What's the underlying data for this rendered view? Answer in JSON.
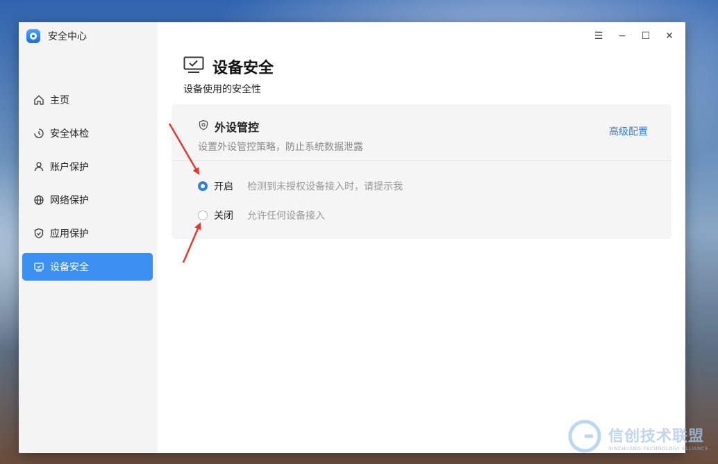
{
  "app": {
    "title": "安全中心"
  },
  "sidebar": {
    "items": [
      {
        "label": "主页",
        "icon": "home-icon"
      },
      {
        "label": "安全体检",
        "icon": "scan-icon"
      },
      {
        "label": "账户保护",
        "icon": "user-icon"
      },
      {
        "label": "网络保护",
        "icon": "globe-icon"
      },
      {
        "label": "应用保护",
        "icon": "shield-check-icon"
      },
      {
        "label": "设备安全",
        "icon": "monitor-check-icon",
        "active": true
      }
    ]
  },
  "window_controls": {
    "menu": "☰",
    "minimize": "−",
    "maximize": "☐",
    "close": "✕"
  },
  "page": {
    "title": "设备安全",
    "subtitle": "设备使用的安全性",
    "icon": "monitor-check-icon"
  },
  "card": {
    "title": "外设管控",
    "icon": "shield-icon",
    "description": "设置外设管控策略，防止系统数据泄露",
    "advanced_link": "高级配置",
    "options": [
      {
        "label": "开启",
        "desc": "检测到未授权设备接入时，请提示我",
        "selected": true
      },
      {
        "label": "关闭",
        "desc": "允许任何设备接入",
        "selected": false
      }
    ]
  },
  "watermark": {
    "main": "信创技术联盟",
    "sub": "XINCHUANG TECHNOLOGY ALLIANCE"
  },
  "colors": {
    "accent": "#3b8ff0",
    "link": "#2f7fe0",
    "annotation": "#e8382b"
  }
}
